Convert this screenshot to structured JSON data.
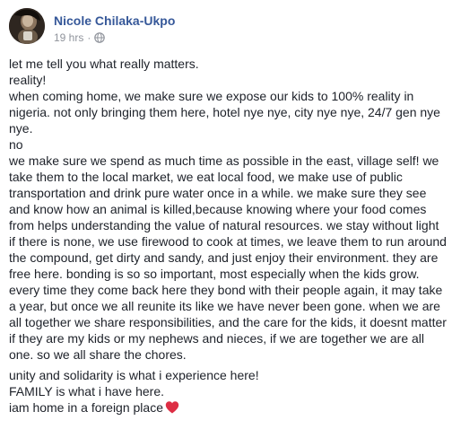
{
  "post": {
    "author": "Nicole Chilaka-Ukpo",
    "timestamp": "19 hrs",
    "separator": "·",
    "privacy_icon": "globe-icon",
    "paragraph_1": "let me tell you what really matters.\nreality!\nwhen coming home, we make sure we expose our kids to 100% reality in nigeria. not only bringing them here, hotel nye nye, city nye nye, 24/7 gen nye nye.\nno\nwe make sure we spend as much time as possible in the east, village self! we take them to the local market, we eat local food, we make use of public transportation and drink pure water once in a while. we make sure they see and know how an animal is killed,because knowing where your food comes from helps understanding the value of natural resources. we stay without light if there is none, we use firewood to cook at times, we leave them to run around the compound, get dirty and sandy, and just enjoy their environment. they are free here. bonding is so so important, most especially when the kids grow. every time they come back here they bond with their people again, it may take a year, but once we all reunite its like we have never been gone. when we are all together we share responsibilities, and the care for the kids, it doesnt matter if they are my kids or my nephews and nieces, if we are together we are all one. so we all share the chores.",
    "paragraph_2": "unity and solidarity is what i experience here!\nFAMILY is what i have here.\niam home in a foreign place",
    "emoji_icon": "red-heart-icon",
    "colors": {
      "author_link": "#365899",
      "meta_gray": "#90949c",
      "text": "#1d2129",
      "heart": "#dd2e44"
    }
  }
}
